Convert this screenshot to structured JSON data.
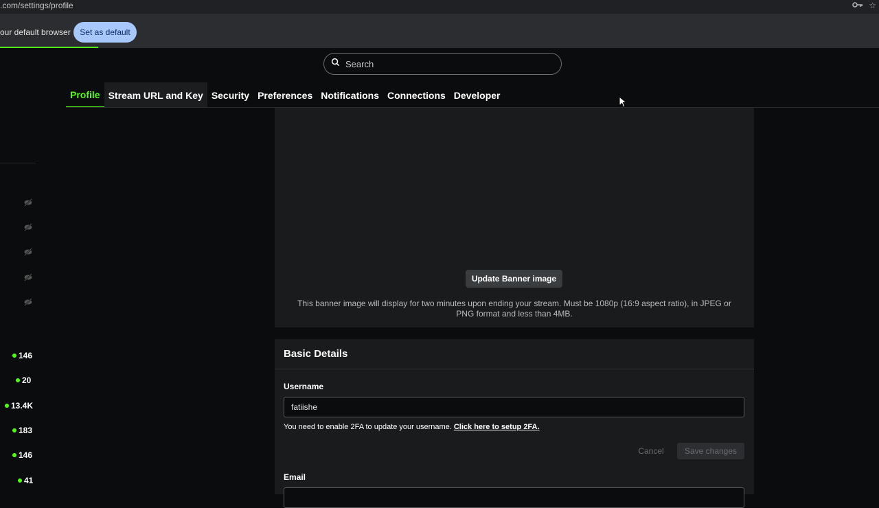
{
  "browser": {
    "url": ".com/settings/profile",
    "infobar_message": "our default browser",
    "set_default_label": "Set as default"
  },
  "search": {
    "placeholder": "Search"
  },
  "tabs": [
    {
      "label": "Profile",
      "active": true
    },
    {
      "label": "Stream URL and Key"
    },
    {
      "label": "Security"
    },
    {
      "label": "Preferences"
    },
    {
      "label": "Notifications"
    },
    {
      "label": "Connections"
    },
    {
      "label": "Developer"
    }
  ],
  "sidebar": {
    "counts": [
      "146",
      "20",
      "13.4K",
      "183",
      "146",
      "41"
    ]
  },
  "banner": {
    "button_label": "Update Banner image",
    "note": "This banner image will display for two minutes upon ending your stream. Must be 1080p (16:9 aspect ratio), in JPEG or PNG format and less than 4MB."
  },
  "basic_details": {
    "title": "Basic Details",
    "username_label": "Username",
    "username_value": "fatiishe",
    "hint_text": "You need to enable 2FA to update your username.",
    "hint_link": "Click here to setup 2FA.",
    "cancel_label": "Cancel",
    "save_label": "Save changes",
    "email_label": "Email"
  },
  "colors": {
    "accent": "#53fc18",
    "background": "#0b0c0d",
    "panel": "#191b1d"
  }
}
